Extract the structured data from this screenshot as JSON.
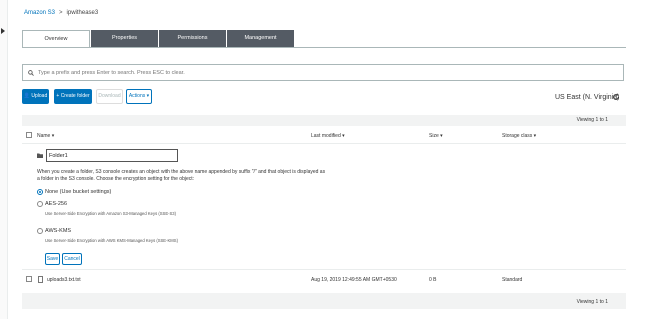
{
  "breadcrumb": {
    "root": "Amazon S3",
    "separator": ">",
    "bucket": "ipwithease3"
  },
  "tabs": [
    {
      "label": "Overview",
      "active": true
    },
    {
      "label": "Properties",
      "active": false
    },
    {
      "label": "Permissions",
      "active": false
    },
    {
      "label": "Management",
      "active": false
    }
  ],
  "search": {
    "placeholder": "Type a prefix and press Enter to search. Press ESC to clear."
  },
  "toolbar": {
    "upload": "Upload",
    "create_folder": "+ Create folder",
    "download": "Download",
    "actions": "Actions ▾"
  },
  "region": "US East (N. Virginia)",
  "viewing_top": "Viewing 1 to 1",
  "viewing_bottom": "Viewing 1 to 1",
  "columns": {
    "name": "Name ▾",
    "last_modified": "Last modified ▾",
    "size": "Size ▾",
    "storage_class": "Storage class ▾"
  },
  "create_folder_panel": {
    "folder_name_value": "Folder1",
    "description": "When you create a folder, S3 console creates an object with the above name appended by suffix \"/\" and that object is displayed as a folder in the S3 console. Choose the encryption setting for the object:",
    "options": [
      {
        "label": "None (Use bucket settings)",
        "sub": "",
        "selected": true
      },
      {
        "label": "AES-256",
        "sub": "Use Server-Side Encryption with Amazon S3-Managed Keys (SSE-S3)",
        "selected": false
      },
      {
        "label": "AWS-KMS",
        "sub": "Use Server-Side Encryption with AWS KMS-Managed Keys (SSE-KMS)",
        "selected": false
      }
    ],
    "save": "Save",
    "cancel": "Cancel"
  },
  "files": [
    {
      "name": "uploads3.txt.txt",
      "last_modified": "Aug 19, 2019 12:49:55 AM GMT+0530",
      "size": "0 B",
      "storage_class": "Standard"
    }
  ],
  "colors": {
    "accent": "#0073bb",
    "tab_dark": "#545b64"
  }
}
